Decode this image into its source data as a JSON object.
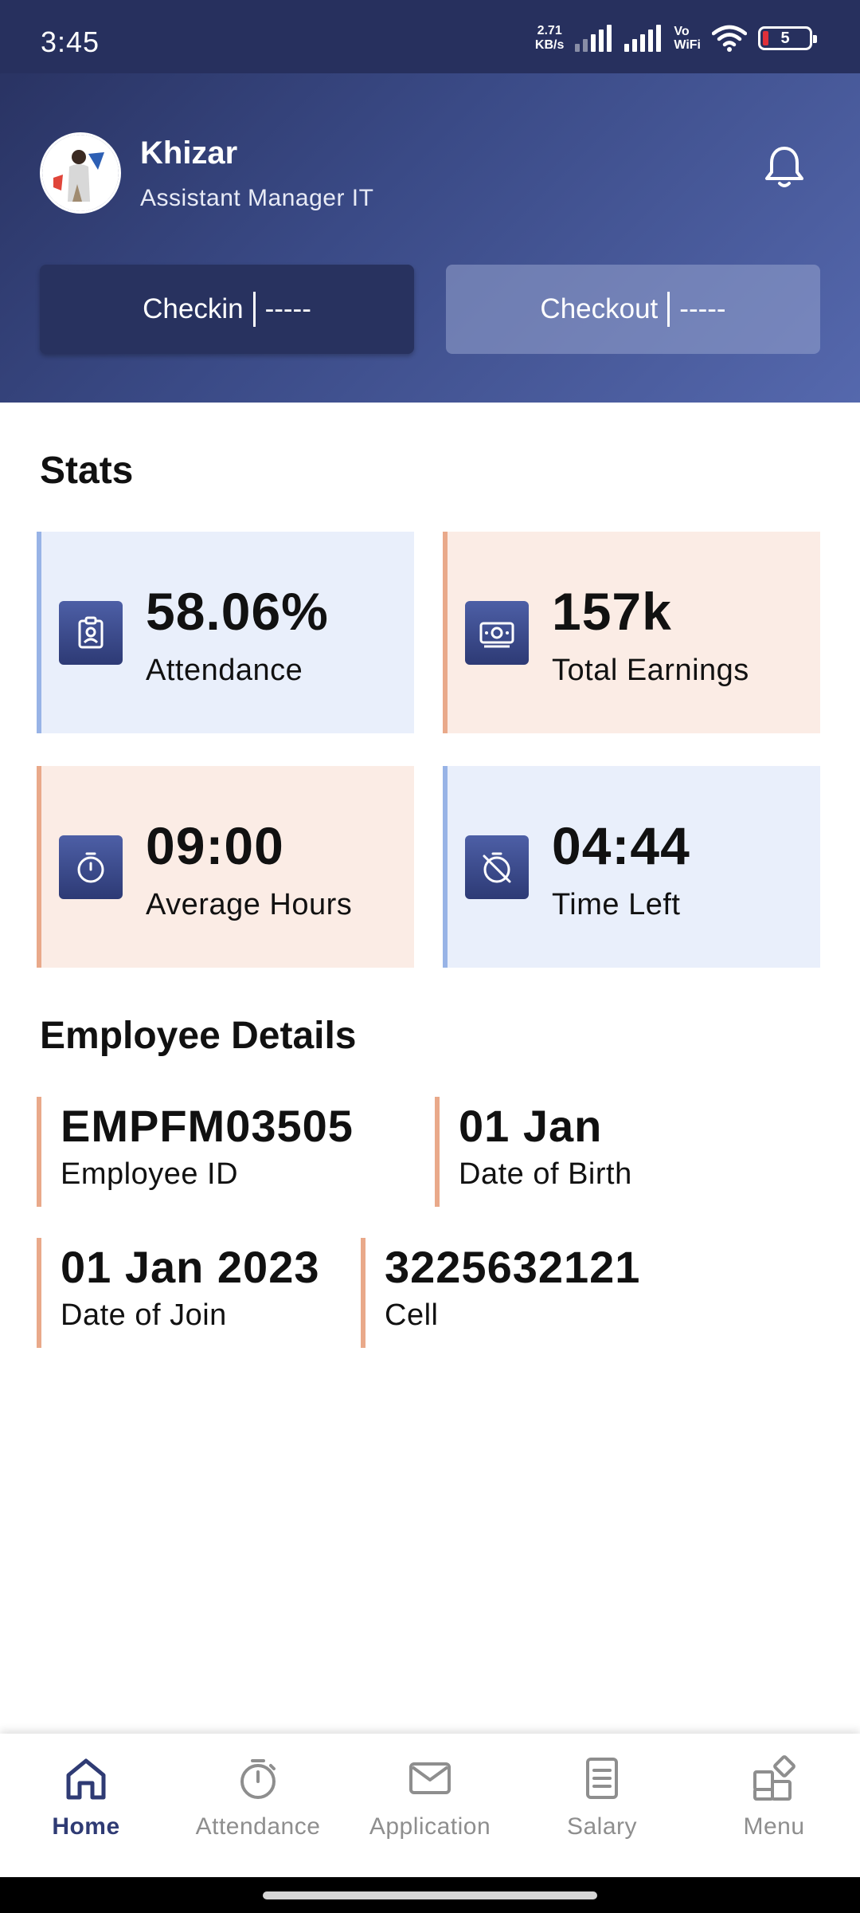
{
  "status_bar": {
    "time": "3:45",
    "net_speed_value": "2.71",
    "net_speed_unit": "KB/s",
    "vo_label": "Vo",
    "wifi_label": "WiFi",
    "battery": "5"
  },
  "profile": {
    "name": "Khizar",
    "role": "Assistant Manager IT"
  },
  "attendance_actions": {
    "checkin_label": "Checkin",
    "checkin_time": "-----",
    "checkout_label": "Checkout",
    "checkout_time": "-----"
  },
  "stats": {
    "title": "Stats",
    "cards": [
      {
        "value": "58.06%",
        "label": "Attendance",
        "icon": "clipboard-id-icon",
        "color": "#e9effb"
      },
      {
        "value": "157k",
        "label": "Total Earnings",
        "icon": "money-icon",
        "color": "#fbece5"
      },
      {
        "value": "09:00",
        "label": "Average Hours",
        "icon": "stopwatch-icon",
        "color": "#fbece5"
      },
      {
        "value": "04:44",
        "label": "Time Left",
        "icon": "timer-off-icon",
        "color": "#e9effb"
      }
    ]
  },
  "employee_details": {
    "title": "Employee Details",
    "items": [
      {
        "value": "EMPFM03505",
        "label": "Employee ID"
      },
      {
        "value": "01 Jan",
        "label": "Date of Birth"
      },
      {
        "value": "01 Jan 2023",
        "label": "Date of Join"
      },
      {
        "value": "3225632121",
        "label": "Cell"
      }
    ]
  },
  "bottom_nav": {
    "items": [
      {
        "label": "Home",
        "icon": "home-icon",
        "active": true
      },
      {
        "label": "Attendance",
        "icon": "stopwatch-icon",
        "active": false
      },
      {
        "label": "Application",
        "icon": "mail-icon",
        "active": false
      },
      {
        "label": "Salary",
        "icon": "document-icon",
        "active": false
      },
      {
        "label": "Menu",
        "icon": "grid-icon",
        "active": false
      }
    ]
  },
  "colors": {
    "header_dark": "#27305e",
    "header_light": "#5568ad",
    "accent_peach": "#e9a98a",
    "accent_blue": "#98b3e6",
    "nav_active": "#2f3b74"
  }
}
